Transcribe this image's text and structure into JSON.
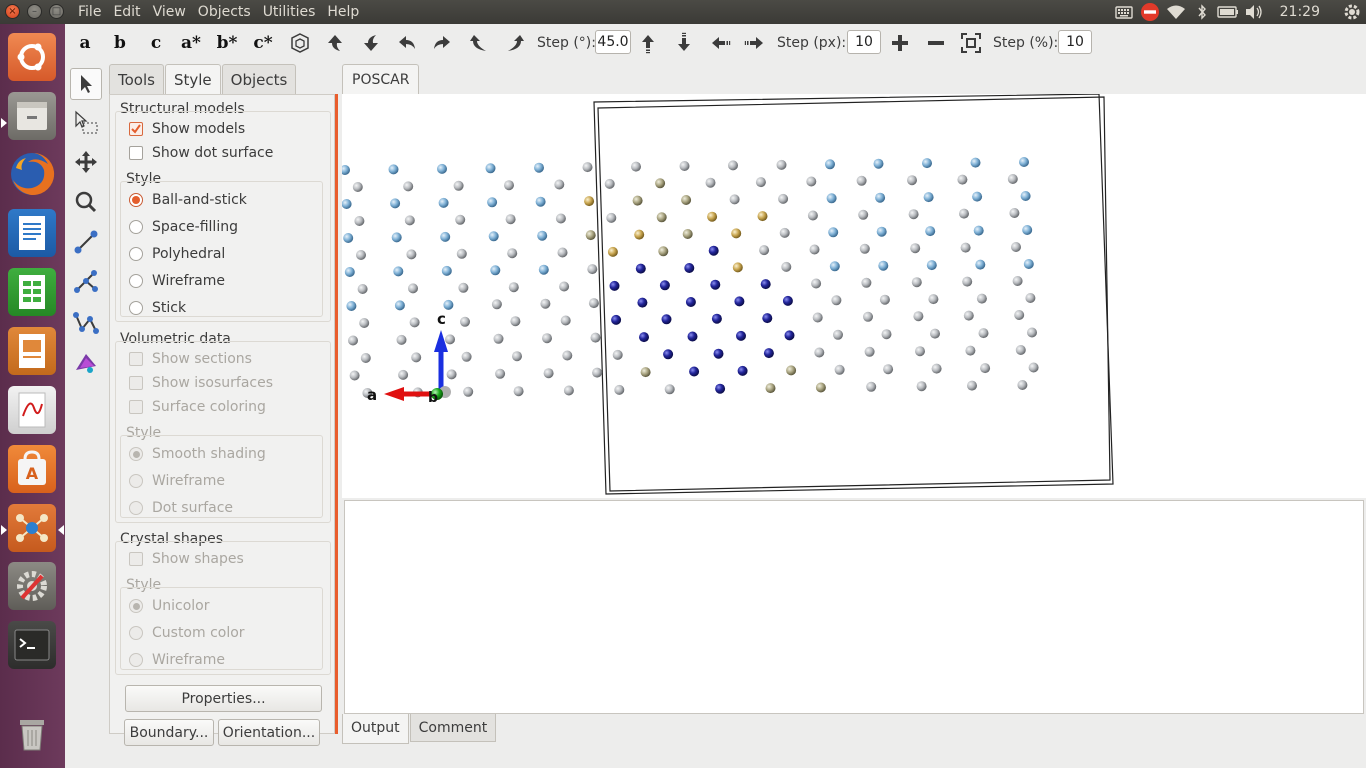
{
  "window": {
    "close": "×",
    "minimize": "–",
    "maximize": "□"
  },
  "menubar": [
    "File",
    "Edit",
    "View",
    "Objects",
    "Utilities",
    "Help"
  ],
  "tray": {
    "clock": "21:29"
  },
  "launcher_apps": [
    "ubuntu-dash",
    "files",
    "firefox",
    "writer",
    "calc",
    "impress",
    "document-viewer",
    "software-center",
    "vesta",
    "system-settings",
    "terminal",
    "trash"
  ],
  "toolbar": {
    "axes": [
      "a",
      "b",
      "c",
      "a*",
      "b*",
      "c*"
    ],
    "step_deg_label": "Step (°):",
    "step_deg_value": "45.0",
    "step_px_label": "Step (px):",
    "step_px_value": "10",
    "step_pct_label": "Step (%):",
    "step_pct_value": "10"
  },
  "tabs": {
    "tools": "Tools",
    "style": "Style",
    "objects": "Objects"
  },
  "style_panel": {
    "structural_title": "Structural models",
    "show_models": "Show models",
    "show_dot_surface": "Show dot surface",
    "style_title": "Style",
    "styles": [
      "Ball-and-stick",
      "Space-filling",
      "Polyhedral",
      "Wireframe",
      "Stick"
    ],
    "volumetric_title": "Volumetric data",
    "show_sections": "Show sections",
    "show_isosurfaces": "Show isosurfaces",
    "surface_coloring": "Surface coloring",
    "vol_style_title": "Style",
    "vol_styles": [
      "Smooth shading",
      "Wireframe",
      "Dot surface"
    ],
    "crystal_title": "Crystal shapes",
    "show_shapes": "Show shapes",
    "crystal_style_title": "Style",
    "crystal_styles": [
      "Unicolor",
      "Custom color",
      "Wireframe"
    ]
  },
  "buttons": {
    "properties": "Properties...",
    "boundary": "Boundary...",
    "orientation": "Orientation..."
  },
  "document_tab": "POSCAR",
  "axis_labels": {
    "a": "a",
    "b": "b",
    "c": "c"
  },
  "output_tabs": {
    "output": "Output",
    "comment": "Comment"
  },
  "colors": {
    "accent": "#e95d2d",
    "atom_grey": "#b9bcc0",
    "atom_blue_light": "#7fb1d6",
    "atom_navy": "#23269c",
    "atom_gold": "#c9a650",
    "axis_a": "#e01010",
    "axis_c": "#1a2fe0",
    "axis_b": "#18a818"
  }
}
